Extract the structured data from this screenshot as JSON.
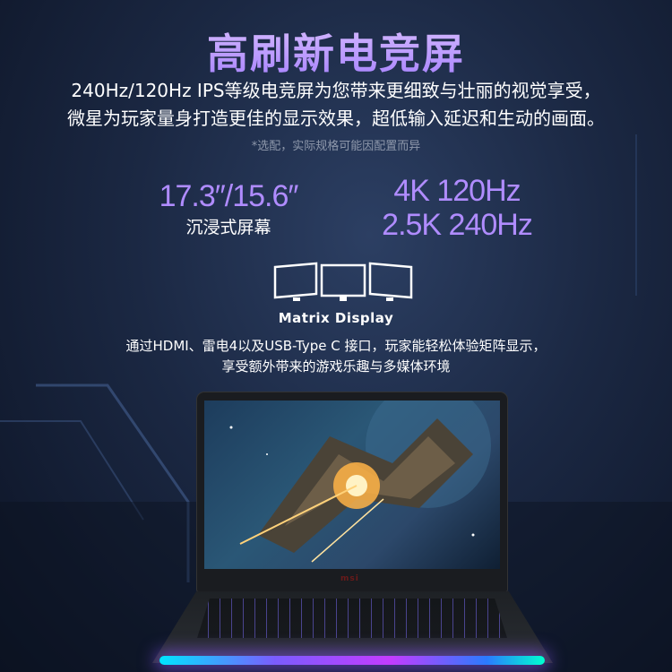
{
  "title": "高刷新电竞屏",
  "intro": {
    "line1": "240Hz/120Hz IPS等级电竞屏为您带来更细致与壮丽的视觉享受，",
    "line2": "微星为玩家量身打造更佳的显示效果，超低输入延迟和生动的画面。"
  },
  "note": "*选配，实际规格可能因配置而异",
  "specs": {
    "size": "17.3″/15.6″",
    "size_label": "沉浸式屏幕",
    "res1": "4K 120Hz",
    "res2": "2.5K 240Hz"
  },
  "matrix": {
    "label": "Matrix Display",
    "desc1": "通过HDMI、雷电4以及USB-Type C 接口，玩家能轻松体验矩阵显示，",
    "desc2": "享受额外带来的游戏乐趣与多媒体环境"
  },
  "laptop": {
    "brand": "msi"
  },
  "colors": {
    "accent": "#b08cff",
    "background": "#1b2843"
  }
}
